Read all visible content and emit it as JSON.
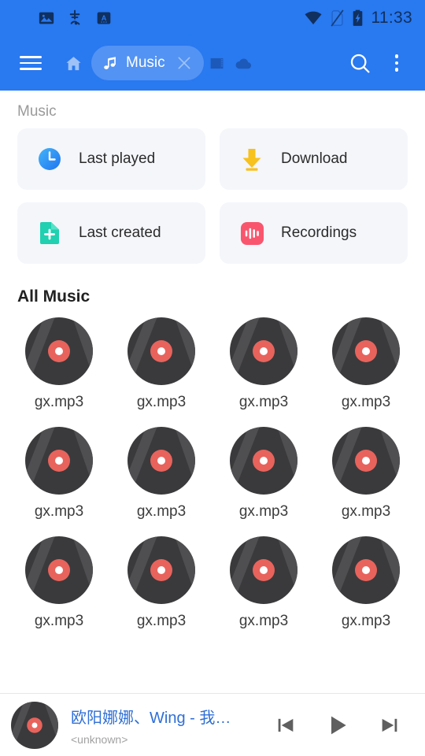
{
  "statusbar": {
    "time": "11:33",
    "left_icons": [
      "image-icon",
      "pinyin-input-icon",
      "text-a-icon"
    ],
    "right_icons": [
      "wifi-icon",
      "sim-card-off-icon",
      "battery-charging-icon"
    ],
    "bar_color": "#2979f0",
    "icon_color": "#10305f"
  },
  "toolbar": {
    "menu_label": "menu-icon",
    "home_label": "home-icon",
    "tab": {
      "label": "Music",
      "icon": "music-note-icon",
      "close": "close-icon"
    },
    "ebook_label": "ebook-icon",
    "cloud_label": "cloud-icon",
    "search_label": "search-icon",
    "overflow_label": "more-vert-icon"
  },
  "breadcrumb": {
    "label": "Music"
  },
  "quick_cards": [
    {
      "label": "Last played",
      "icon": "clock-icon",
      "color": "#2e93f7"
    },
    {
      "label": "Download",
      "icon": "download-icon",
      "color": "#f7c11e"
    },
    {
      "label": "Last created",
      "icon": "file-plus-icon",
      "color": "#20d0b0"
    },
    {
      "label": "Recordings",
      "icon": "waveform-icon",
      "color": "#f9566e"
    }
  ],
  "all_music": {
    "title": "All Music",
    "items": [
      {
        "name": "gx.mp3"
      },
      {
        "name": "gx.mp3"
      },
      {
        "name": "gx.mp3"
      },
      {
        "name": "gx.mp3"
      },
      {
        "name": "gx.mp3"
      },
      {
        "name": "gx.mp3"
      },
      {
        "name": "gx.mp3"
      },
      {
        "name": "gx.mp3"
      },
      {
        "name": "gx.mp3"
      },
      {
        "name": "gx.mp3"
      },
      {
        "name": "gx.mp3"
      },
      {
        "name": "gx.mp3"
      }
    ]
  },
  "player": {
    "title": "欧阳娜娜、Wing - 我…",
    "artist": "<unknown>",
    "art": "vinyl-record-icon",
    "prev": "skip-previous-icon",
    "play": "play-icon",
    "next": "skip-next-icon",
    "title_color": "#2f6fd6"
  },
  "theme": {
    "primary": "#2979f0",
    "card_bg": "#f4f6fa",
    "disc_dark": "#3a3a3c",
    "disc_label": "#e8635c"
  }
}
